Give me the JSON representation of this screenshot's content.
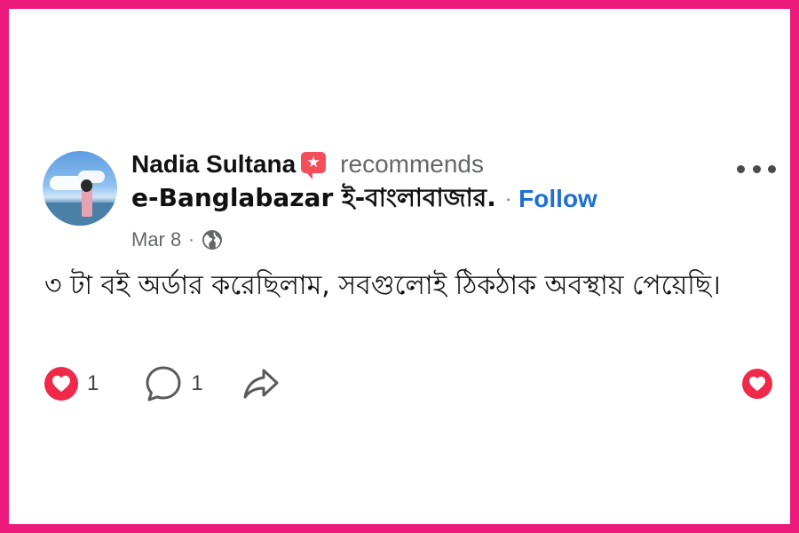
{
  "post": {
    "author": "Nadia Sultana",
    "recommends_label": "recommends",
    "page_name": "e-Banglabazar ই-বাংলাবাজার.",
    "separator": "·",
    "follow_label": "Follow",
    "date": "Mar 8",
    "date_separator": "·",
    "privacy_icon": "globe-icon",
    "body_text": "৩ টা বই অর্ডার করেছিলাম, সবগুলোই ঠিকঠাক অবস্থায় পেয়েছি।"
  },
  "actions": {
    "reaction_count": "1",
    "comment_count": "1",
    "reaction_icon": "heart-icon",
    "comment_icon": "comment-bubble-icon",
    "share_icon": "share-arrow-icon"
  },
  "colors": {
    "frame_border": "#ec1a7d",
    "follow": "#1f6fd6",
    "heart": "#f02849",
    "recommend_badge": "#f44e5b",
    "meta_text": "#65676b"
  }
}
